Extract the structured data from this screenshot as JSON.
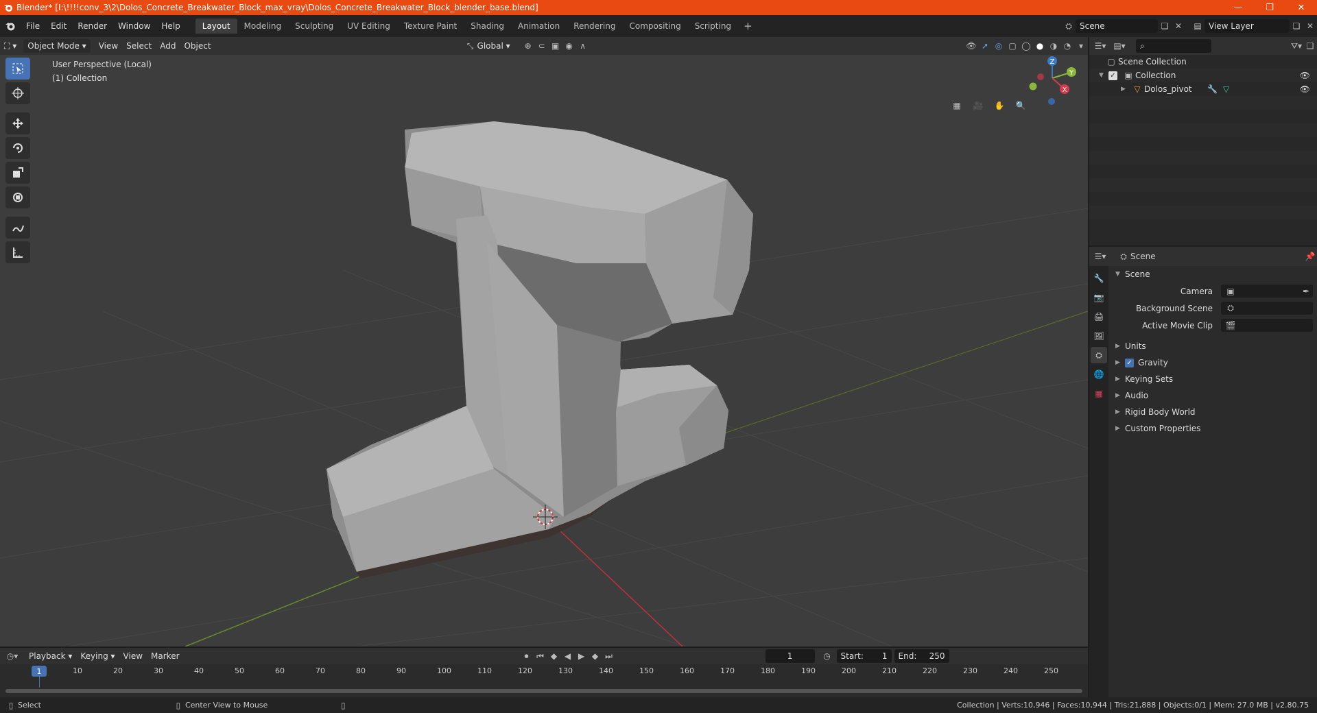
{
  "window": {
    "title": "Blender* [I:\\!!!!conv_3\\2\\Dolos_Concrete_Breakwater_Block_max_vray\\Dolos_Concrete_Breakwater_Block_blender_base.blend]",
    "minimize": "—",
    "restore": "❐",
    "close": "✕"
  },
  "menu": [
    "File",
    "Edit",
    "Render",
    "Window",
    "Help"
  ],
  "workspaces": [
    "Layout",
    "Modeling",
    "Sculpting",
    "UV Editing",
    "Texture Paint",
    "Shading",
    "Animation",
    "Rendering",
    "Compositing",
    "Scripting"
  ],
  "active_workspace": "Layout",
  "scene_name": "Scene",
  "view_layer": "View Layer",
  "viewport": {
    "mode": "Object Mode",
    "menus": [
      "View",
      "Select",
      "Add",
      "Object"
    ],
    "orientation": "Global",
    "info_line1": "User Perspective (Local)",
    "info_line2": "(1) Collection",
    "gizmo": {
      "x": "X",
      "y": "Y",
      "z": "Z"
    }
  },
  "outliner": {
    "root": "Scene Collection",
    "collection": "Collection",
    "object": "Dolos_pivot"
  },
  "properties": {
    "header": "Scene",
    "panel": "Scene",
    "camera_label": "Camera",
    "background_label": "Background Scene",
    "movie_clip_label": "Active Movie Clip",
    "subpanels": [
      "Units",
      "Gravity",
      "Keying Sets",
      "Audio",
      "Rigid Body World",
      "Custom Properties"
    ]
  },
  "timeline": {
    "menus": [
      "Playback",
      "Keying",
      "View",
      "Marker"
    ],
    "current_frame": "1",
    "start_label": "Start:",
    "start": "1",
    "end_label": "End:",
    "end": "250",
    "ticks": [
      "10",
      "20",
      "30",
      "40",
      "50",
      "60",
      "70",
      "80",
      "90",
      "100",
      "110",
      "120",
      "130",
      "140",
      "150",
      "160",
      "170",
      "180",
      "190",
      "200",
      "210",
      "220",
      "230",
      "240",
      "250"
    ],
    "playhead": "1"
  },
  "status": {
    "left": "Select",
    "middle": "Center View to Mouse",
    "right": "Collection | Verts:10,946 | Faces:10,944 | Tris:21,888 | Objects:0/1 | Mem: 27.0 MB | v2.80.75"
  }
}
